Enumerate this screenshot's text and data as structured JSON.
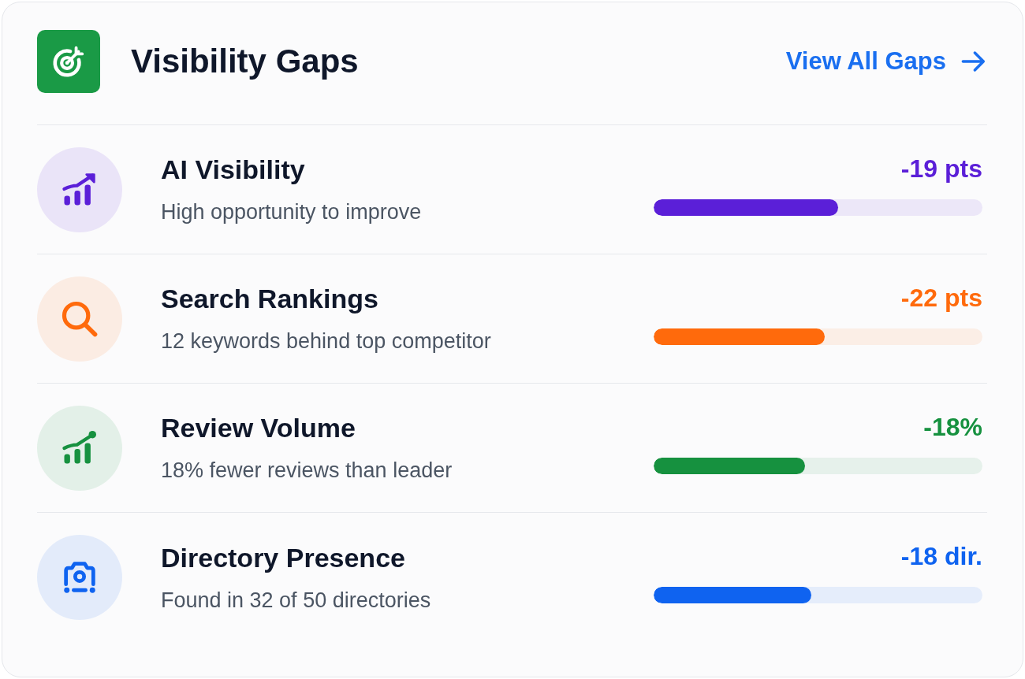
{
  "header": {
    "title": "Visibility Gaps",
    "link": "View All Gaps"
  },
  "gaps": [
    {
      "kind": "trend",
      "title": "AI Visibility",
      "subtitle": "High opportunity to improve",
      "value": "-19 pts",
      "level": 0.56,
      "color": "#5b1fd8"
    },
    {
      "kind": "search",
      "title": "Search Rankings",
      "subtitle": "12 keywords behind top competitor",
      "value": "-22 pts",
      "level": 0.52,
      "color": "#ff6a0c"
    },
    {
      "kind": "growth",
      "title": "Review Volume",
      "subtitle": "18% fewer reviews than leader",
      "value": "-18%",
      "level": 0.46,
      "color": "#16913f"
    },
    {
      "kind": "camera",
      "title": "Directory Presence",
      "subtitle": "Found in 32 of 50 directories",
      "value": "-18 dir.",
      "level": 0.48,
      "color": "#0f63f0"
    }
  ]
}
